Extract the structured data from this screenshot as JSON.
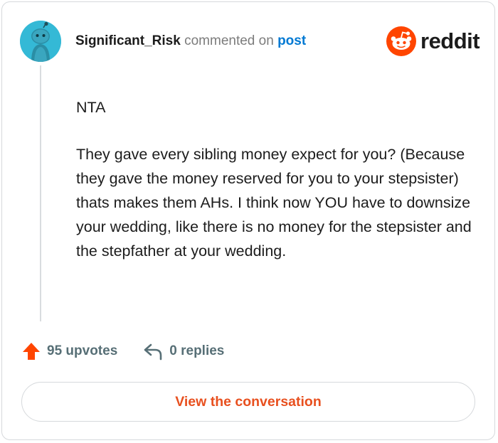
{
  "comment": {
    "username": "Significant_Risk",
    "commented_on_text": "commented on",
    "post_link_label": "post",
    "paragraphs": [
      "NTA",
      "They gave every sibling money expect for you? (Because they gave the money reserved for you to your stepsister) thats makes them AHs. I think now YOU have to downsize your wedding, like there is no money for the stepsister and the stepfather at your wedding."
    ]
  },
  "brand": {
    "wordmark": "reddit",
    "color": "#ff4500"
  },
  "actions": {
    "upvotes_label": "95 upvotes",
    "replies_label": "0 replies"
  },
  "cta": {
    "label": "View the conversation"
  },
  "colors": {
    "avatar_bg": "#34b9d6",
    "link": "#0079d3",
    "upvote": "#ff4500",
    "cta_text": "#e8501f",
    "meta_text": "#576f76"
  },
  "icons": {
    "avatar": "snoo-avatar-icon",
    "logo": "reddit-logo-icon",
    "upvote": "upvote-arrow-icon",
    "reply": "reply-arrow-icon"
  }
}
